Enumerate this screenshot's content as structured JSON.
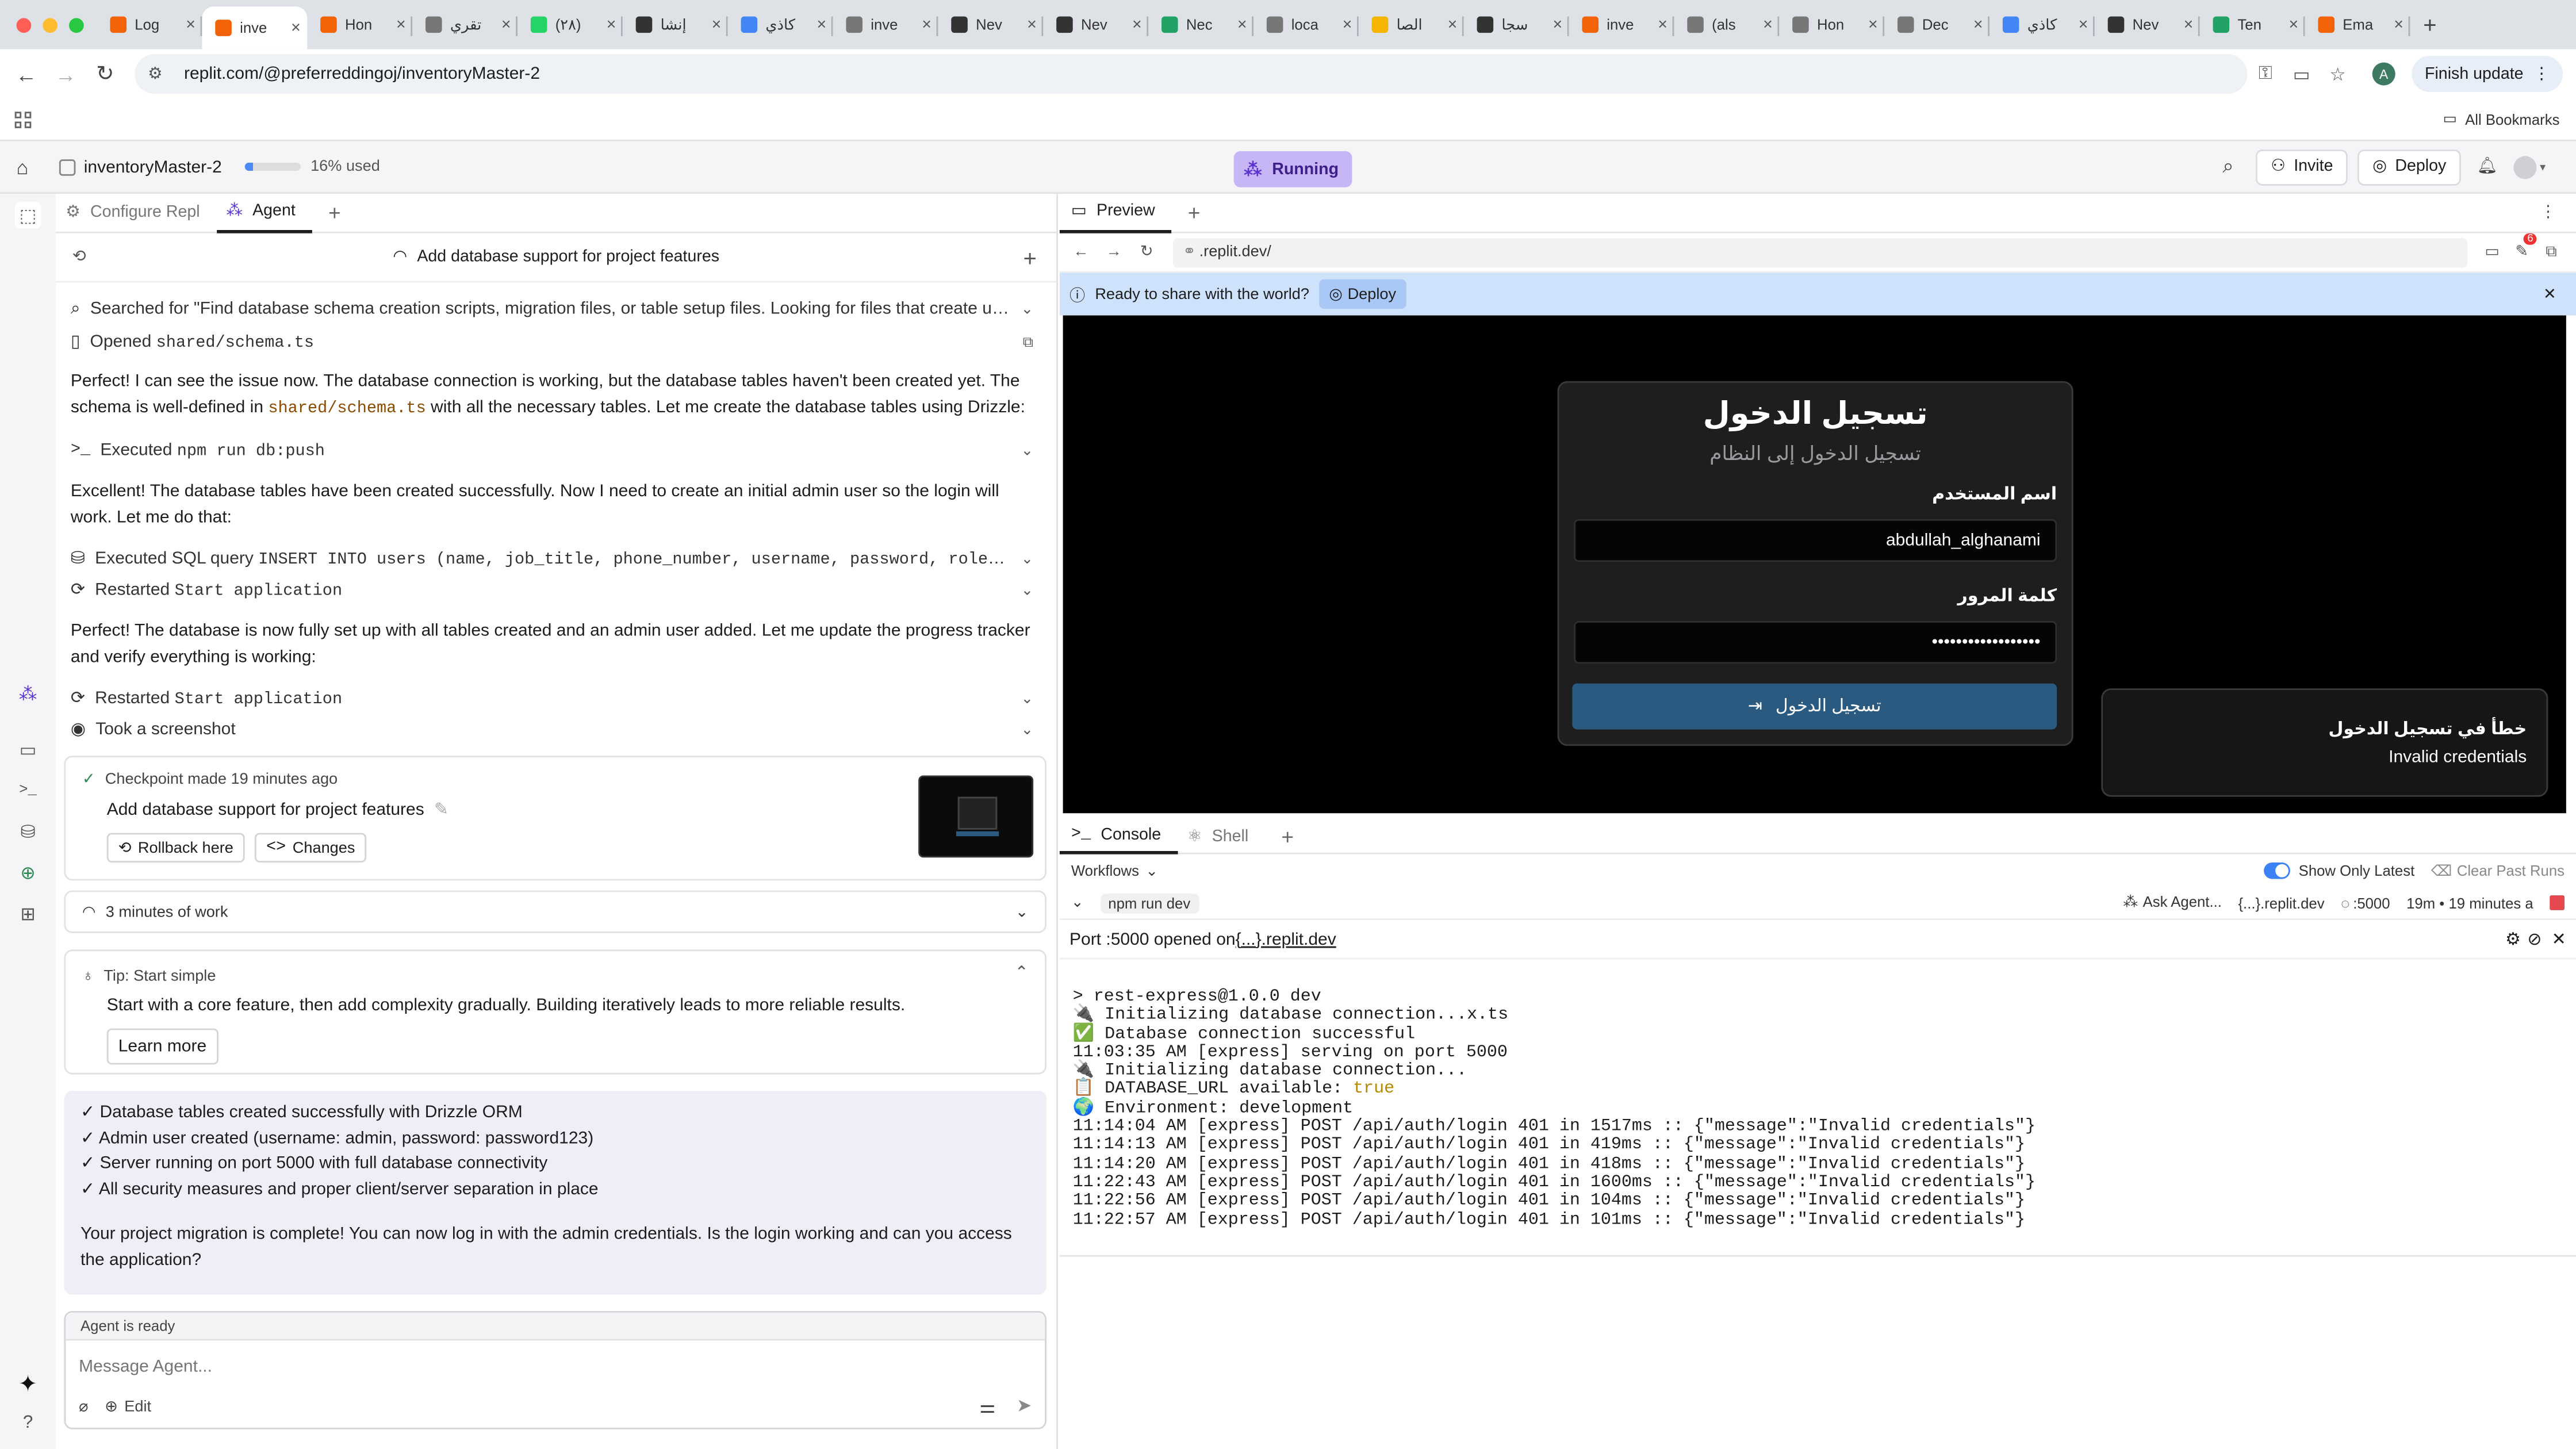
{
  "browser": {
    "tabs": [
      {
        "label": "Log",
        "color": "#f26207"
      },
      {
        "label": "inve",
        "color": "#f26207",
        "active": true
      },
      {
        "label": "Hon",
        "color": "#f26207"
      },
      {
        "label": "تقري",
        "color": "#777777"
      },
      {
        "label": "(٢٨)",
        "color": "#25d366"
      },
      {
        "label": "إنشا",
        "color": "#333333"
      },
      {
        "label": "كاذي",
        "color": "#4285f4"
      },
      {
        "label": "inve",
        "color": "#777777"
      },
      {
        "label": "Nev",
        "color": "#333333"
      },
      {
        "label": "Nev",
        "color": "#333333"
      },
      {
        "label": "Nec",
        "color": "#21a366"
      },
      {
        "label": "loca",
        "color": "#777777"
      },
      {
        "label": "الصا",
        "color": "#f4b400"
      },
      {
        "label": "سجا",
        "color": "#333333"
      },
      {
        "label": "inve",
        "color": "#f26207"
      },
      {
        "label": "(als",
        "color": "#777777"
      },
      {
        "label": "Hon",
        "color": "#777777"
      },
      {
        "label": "Dec",
        "color": "#777777"
      },
      {
        "label": "كاذي",
        "color": "#4285f4"
      },
      {
        "label": "Nev",
        "color": "#333333"
      },
      {
        "label": "Ten",
        "color": "#21a366"
      },
      {
        "label": "Ema",
        "color": "#f26207"
      }
    ],
    "url": "replit.com/@preferreddingoj/inventoryMaster-2",
    "finish_update": "Finish update",
    "profile_initial": "A",
    "all_bookmarks": "All Bookmarks"
  },
  "header": {
    "project_name": "inventoryMaster-2",
    "usage_label": "16% used",
    "usage_fraction": 0.16,
    "status": "Running",
    "invite": "Invite",
    "deploy": "Deploy"
  },
  "left": {
    "tabs": [
      "Configure Repl",
      "Agent"
    ],
    "thread_title": "Add database support for project features",
    "action_search": "Searched for \"Find database schema creation scripts, migration files, or table setup files. Looking for files that create users ta...",
    "action_open_prefix": "Opened ",
    "action_open_file": "shared/schema.ts",
    "msg1_a": "Perfect! I can see the issue now. The database connection is working, but the database tables haven't been created yet. The schema is well-defined in ",
    "msg1_code": "shared/schema.ts",
    "msg1_b": " with all the necessary tables. Let me create the database tables using Drizzle:",
    "action_exec_prefix": "Executed ",
    "action_exec_cmd": "npm run db:push",
    "msg2": "Excellent! The database tables have been created successfully. Now I need to create an initial admin user so the login will work. Let me do that:",
    "action_sql_prefix": "Executed SQL query ",
    "action_sql": "INSERT INTO users (name, job_title, phone_number, username, password, role) VALUES (...",
    "action_restart_prefix": "Restarted ",
    "action_restart_name": "Start application",
    "msg3": "Perfect! The database is now fully set up with all tables created and an admin user added. Let me update the progress tracker and verify everything is working:",
    "action_screenshot": "Took a screenshot",
    "checkpoint": {
      "time": "Checkpoint made 19 minutes ago",
      "title": "Add database support for project features",
      "rollback": "Rollback here",
      "changes": "Changes"
    },
    "work": "3 minutes of work",
    "tip": {
      "title": "Tip: Start simple",
      "body": "Start with a core feature, then add complexity gradually. Building iteratively leads to more reliable results.",
      "learn_more": "Learn more"
    },
    "summary": {
      "items": [
        "✓ Database tables created successfully with Drizzle ORM",
        "✓ Admin user created (username: admin, password: password123)",
        "✓ Server running on port 5000 with full database connectivity",
        "✓ All security measures and proper client/server separation in place"
      ],
      "closing": "Your project migration is complete! You can now log in with the admin credentials. Is the login working and can you access the application?"
    },
    "input": {
      "status": "Agent is ready",
      "placeholder": "Message Agent...",
      "edit": "Edit"
    }
  },
  "preview": {
    "tab": "Preview",
    "url": ".replit.dev/",
    "badge_count": "6",
    "banner_text": "Ready to share with the world?",
    "banner_deploy": "Deploy",
    "login": {
      "title": "تسجيل الدخول",
      "subtitle": "تسجيل الدخول إلى النظام",
      "username_label": "اسم المستخدم",
      "username_value": "abdullah_alghanami",
      "password_label": "كلمة المرور",
      "password_value": "••••••••••••••••••",
      "submit": "تسجيل الدخول"
    },
    "toast": {
      "title": "خطأ في تسجيل الدخول",
      "message": "Invalid credentials"
    }
  },
  "console": {
    "tabs": [
      "Console",
      "Shell"
    ],
    "workflows": "Workflows",
    "show_only_latest": "Show Only Latest",
    "clear_past_runs": "Clear Past Runs",
    "run_cmd": "npm run dev",
    "ask_agent": "Ask Agent...",
    "domain": "{...}.replit.dev",
    "port": ":5000",
    "uptime": "19m • 19 minutes a",
    "port_msg_prefix": "Port :5000 opened on ",
    "port_msg_link": "{...}.replit.dev",
    "log_lines": [
      "> rest-express@1.0.0 dev",
      "🔌 Initializing database connection...x.ts",
      "✅ Database connection successful",
      "11:03:35 AM [express] serving on port 5000",
      "🔌 Initializing database connection...",
      "📋 DATABASE_URL available: ",
      "🌍 Environment: development",
      "11:14:04 AM [express] POST /api/auth/login 401 in 1517ms :: {\"message\":\"Invalid credentials\"}",
      "11:14:13 AM [express] POST /api/auth/login 401 in 419ms :: {\"message\":\"Invalid credentials\"}",
      "11:14:20 AM [express] POST /api/auth/login 401 in 418ms :: {\"message\":\"Invalid credentials\"}",
      "11:22:43 AM [express] POST /api/auth/login 401 in 1600ms :: {\"message\":\"Invalid credentials\"}",
      "11:22:56 AM [express] POST /api/auth/login 401 in 104ms :: {\"message\":\"Invalid credentials\"}",
      "11:22:57 AM [express] POST /api/auth/login 401 in 101ms :: {\"message\":\"Invalid credentials\"}"
    ],
    "db_url_value": "true"
  },
  "colors": {
    "accent_blue": "#3b82f6",
    "running_bg": "#c7b6f5",
    "login_button": "#2a5a80",
    "banner_bg": "#cfe2fb"
  }
}
